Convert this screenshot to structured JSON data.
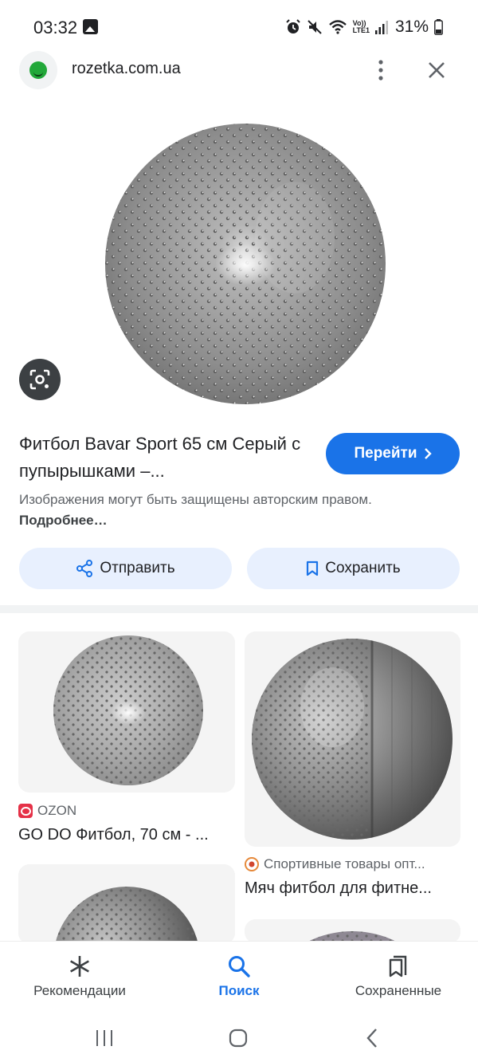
{
  "status_bar": {
    "time": "03:32",
    "battery": "31%",
    "icons": [
      "gallery-icon",
      "alarm-icon",
      "mute-icon",
      "wifi-icon",
      "volte-icon",
      "signal-icon",
      "battery-icon"
    ],
    "volte_label": "Vo))",
    "lte_label": "LTE1"
  },
  "header": {
    "domain": "rozetka.com.ua"
  },
  "result": {
    "title": "Фитбол Bavar Sport 65 см Серый с пупырышками –...",
    "go_button": "Перейти",
    "copyright_text": "Изображения могут быть защищены авторским правом.",
    "copyright_more": "Подробнее…",
    "share_button": "Отправить",
    "save_button": "Сохранить"
  },
  "related": [
    {
      "source": "OZON",
      "title": "GO DO Фитбол, 70 см - ..."
    },
    {
      "source": "Спортивные товары опт...",
      "title": "Мяч фитбол для фитне..."
    }
  ],
  "bottom_nav": {
    "items": [
      {
        "label": "Рекомендации",
        "icon": "asterisk-icon",
        "active": false
      },
      {
        "label": "Поиск",
        "icon": "search-icon",
        "active": true
      },
      {
        "label": "Сохраненные",
        "icon": "saved-icon",
        "active": false
      }
    ]
  },
  "colors": {
    "accent": "#1a73e8",
    "chip_bg": "#e8f0fe",
    "text_primary": "#202124",
    "text_secondary": "#5f6368"
  }
}
